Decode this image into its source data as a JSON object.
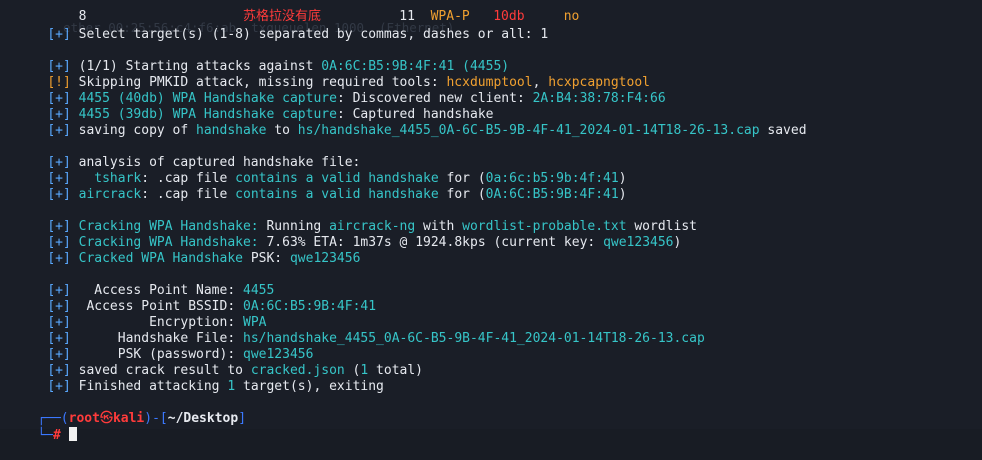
{
  "top_fragment": {
    "col1": "8",
    "col2": "苏格拉没有底",
    "col3": "11",
    "col4": "WPA-P",
    "col5": "10db",
    "col6": "no"
  },
  "ghost_lines": [
    "  ether 00:25:56:c4:f6:ab  txqueuelen 1000  (Ethernet)"
  ],
  "select": {
    "prefix": "[+]",
    "text": "Select target(s) (1-8) separated by commas, dashes or ",
    "all": "all",
    "suffix": ": 1"
  },
  "starting": {
    "prefix": "[+]",
    "count": "(1/1)",
    "text": "Starting attacks against ",
    "bssid": "0A:6C:B5:9B:4F:41",
    "name": "(4455)"
  },
  "skipping": {
    "prefix": "[!]",
    "text": "Skipping PMKID attack, missing required tools: ",
    "tool1": "hcxdumptool",
    "sep": ", ",
    "tool2": "hcxpcapngtool"
  },
  "client": {
    "prefix": "[+]",
    "essid": "4455",
    "db": "(40db)",
    "phase": "WPA Handshake capture",
    "text": ": Discovered new client: ",
    "mac": "2A:B4:38:78:F4:66"
  },
  "captured": {
    "prefix": "[+]",
    "essid": "4455",
    "db": "(39db)",
    "phase": "WPA Handshake capture",
    "text": ": Captured handshake"
  },
  "saving": {
    "prefix": "[+]",
    "text1": "saving copy of ",
    "word": "handshake",
    "text2": " to ",
    "path": "hs/handshake_4455_0A-6C-B5-9B-4F-41_2024-01-14T18-26-13.cap",
    "text3": " saved"
  },
  "analysis": {
    "prefix": "[+]",
    "text": "analysis of captured handshake file:"
  },
  "tshark": {
    "prefix": "[+]",
    "tool": "  tshark",
    "text1": ": .cap file ",
    "valid": "contains a valid handshake",
    "text2": " for ",
    "open": "(",
    "mac": "0a:6c:b5:9b:4f:41",
    "close": ")"
  },
  "aircrack": {
    "prefix": "[+]",
    "tool": "aircrack",
    "text1": ": .cap file ",
    "valid": "contains a valid handshake",
    "text2": " for ",
    "open": "(",
    "mac": "0A:6C:B5:9B:4F:41",
    "close": ")"
  },
  "cracking1": {
    "prefix": "[+]",
    "phase": "Cracking WPA Handshake:",
    "text1": " Running ",
    "tool": "aircrack-ng",
    "text2": " with ",
    "list": "wordlist-probable.txt",
    "text3": " wordlist"
  },
  "cracking2": {
    "prefix": "[+]",
    "phase": "Cracking WPA Handshake:",
    "pct": " 7.63%",
    "text1": " ETA: ",
    "eta": "1m37s",
    "at": " @ ",
    "rate": "1924.8kps",
    "text2": " (current key: ",
    "key": "qwe123456",
    "close": ")"
  },
  "cracked": {
    "prefix": "[+]",
    "phase": "Cracked WPA Handshake",
    "text": " PSK: ",
    "psk": "qwe123456"
  },
  "result": {
    "prefix": "[+]",
    "ap_name_label": "  Access Point Name: ",
    "ap_name": "4455",
    "bssid_label": " Access Point BSSID: ",
    "bssid": "0A:6C:B5:9B:4F:41",
    "enc_label": "         Encryption: ",
    "enc": "WPA",
    "hs_label": "     Handshake File: ",
    "hs": "hs/handshake_4455_0A-6C-B5-9B-4F-41_2024-01-14T18-26-13.cap",
    "psk_label": "     PSK (password): ",
    "psk": "qwe123456"
  },
  "saved": {
    "prefix": "[+]",
    "text1": "saved crack result to ",
    "file": "cracked.json",
    "text2": " (",
    "count": "1",
    "text3": " total)"
  },
  "finished": {
    "prefix": "[+]",
    "text1": "Finished attacking ",
    "count": "1",
    "text2": " target(s), exiting"
  },
  "prompt": {
    "corner_top": "┌──(",
    "user": "root",
    "skull": "㉿",
    "host": "kali",
    "mid": ")-[",
    "path": "~/Desktop",
    "end": "]",
    "corner_bottom": "└─",
    "hash": "#"
  },
  "colors": {
    "background": "#1a1e27",
    "prefix_blue": "#5aa9ff",
    "cyan": "#36c5c8",
    "orange": "#f0a030",
    "red": "#ff3b3b"
  }
}
